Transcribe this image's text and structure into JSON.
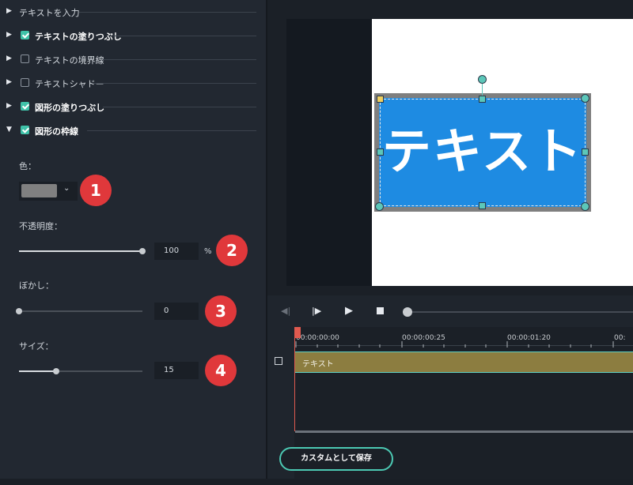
{
  "panel": {
    "sections": [
      {
        "label": "テキストを入力",
        "checkbox": null,
        "bold": false
      },
      {
        "label": "テキストの塗りつぶし",
        "checkbox": true,
        "bold": true
      },
      {
        "label": "テキストの境界線",
        "checkbox": false,
        "bold": false
      },
      {
        "label": "テキストシャドー",
        "checkbox": false,
        "bold": false
      },
      {
        "label": "図形の塗りつぶし",
        "checkbox": true,
        "bold": true
      },
      {
        "label": "図形の枠線",
        "checkbox": true,
        "bold": true,
        "expanded": true
      }
    ],
    "color_label": "色：",
    "color_value": "#808080",
    "opacity_label": "不透明度：",
    "opacity_value": "100",
    "opacity_unit": "%",
    "opacity_fraction": 1.0,
    "blur_label": "ぼかし：",
    "blur_value": "0",
    "blur_fraction": 0.0,
    "size_label": "サイズ：",
    "size_value": "15",
    "size_fraction": 0.3,
    "badges": [
      "1",
      "2",
      "3",
      "4"
    ]
  },
  "preview": {
    "text": "テキスト",
    "fill_color": "#1e8be2",
    "border_color": "#7f7f7f"
  },
  "timeline": {
    "timecodes": [
      "00:00:00:00",
      "00:00:00:25",
      "00:00:01:20",
      "00:"
    ],
    "clip_label": "テキスト"
  },
  "save_button": "カスタムとして保存",
  "colors": {
    "accent": "#3fc1a8",
    "badge": "#e0383b"
  }
}
